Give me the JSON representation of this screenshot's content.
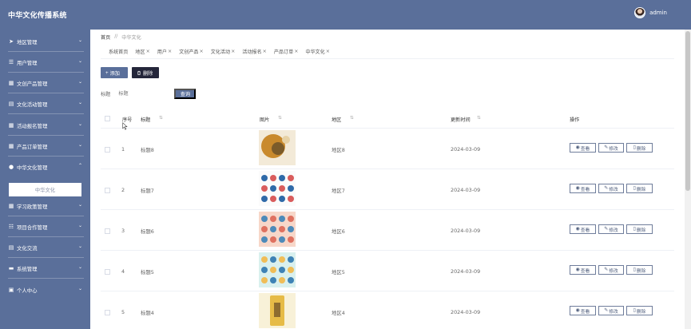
{
  "header": {
    "title": "中华文化传播系统",
    "username": "admin"
  },
  "sidebar": {
    "items": [
      {
        "label": "地区管理",
        "icon": "send-icon"
      },
      {
        "label": "用户管理",
        "icon": "list-icon"
      },
      {
        "label": "文创产品管理",
        "icon": "grid-icon"
      },
      {
        "label": "文化活动管理",
        "icon": "card-icon"
      },
      {
        "label": "活动报名管理",
        "icon": "grid-icon"
      },
      {
        "label": "产品订单管理",
        "icon": "grid-icon"
      },
      {
        "label": "中华文化管理",
        "icon": "user-icon"
      },
      {
        "label": "学习政策管理",
        "icon": "grid-icon"
      },
      {
        "label": "项目合作管理",
        "icon": "sliders-icon"
      },
      {
        "label": "文化交流",
        "icon": "card-icon"
      },
      {
        "label": "系统管理",
        "icon": "chat-icon"
      },
      {
        "label": "个人中心",
        "icon": "window-icon"
      }
    ],
    "active_sub": "中华文化"
  },
  "breadcrumb": {
    "home": "首页",
    "sep": "//",
    "current": "中华文化"
  },
  "tabs": [
    {
      "label": "系统首页",
      "closable": false
    },
    {
      "label": "地区",
      "closable": true
    },
    {
      "label": "用户",
      "closable": true
    },
    {
      "label": "文创产品",
      "closable": true
    },
    {
      "label": "文化活动",
      "closable": true
    },
    {
      "label": "活动报名",
      "closable": true
    },
    {
      "label": "产品订单",
      "closable": true
    },
    {
      "label": "中华文化",
      "closable": true
    }
  ],
  "toolbar": {
    "add_label": "添加",
    "delete_label": "删除",
    "add_icon": "+",
    "delete_icon": "trash-icon"
  },
  "search": {
    "label": "标题",
    "placeholder": "标题",
    "button": "查询"
  },
  "table": {
    "columns": [
      "序号",
      "标题",
      "图片",
      "地区",
      "更新时间",
      "操作"
    ],
    "sort_icon": "⇅",
    "rows": [
      {
        "index": "1",
        "title": "标题8",
        "region": "地区8",
        "updated": "2024-03-09"
      },
      {
        "index": "2",
        "title": "标题7",
        "region": "地区7",
        "updated": "2024-03-09"
      },
      {
        "index": "3",
        "title": "标题6",
        "region": "地区6",
        "updated": "2024-03-09"
      },
      {
        "index": "4",
        "title": "标题5",
        "region": "地区5",
        "updated": "2024-03-09"
      },
      {
        "index": "5",
        "title": "标题4",
        "region": "地区4",
        "updated": "2024-03-09"
      }
    ],
    "actions": {
      "view": "查看",
      "edit": "修改",
      "delete": "删除"
    }
  },
  "colors": {
    "primary": "#5a6f9a",
    "danger_dark": "#24263a",
    "divider": "#eef1f6"
  }
}
